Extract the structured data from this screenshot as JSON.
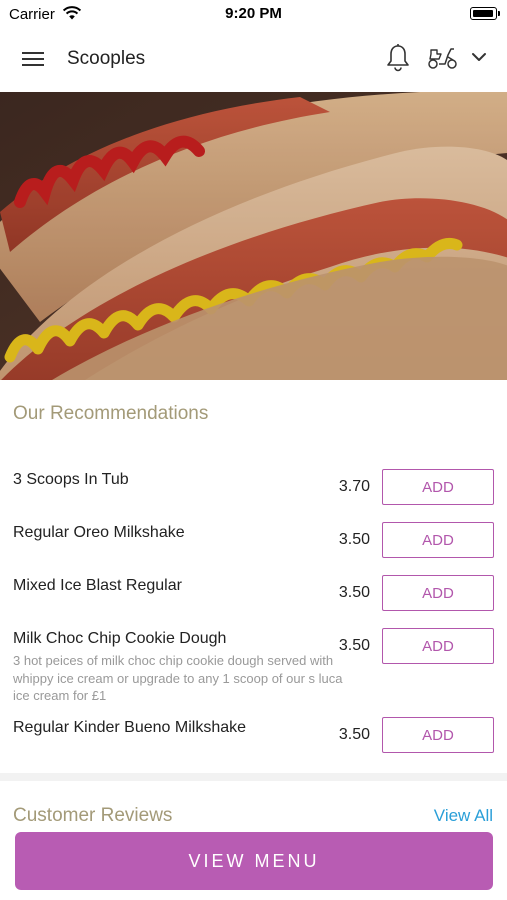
{
  "status_bar": {
    "carrier": "Carrier",
    "time": "9:20 PM"
  },
  "header": {
    "title": "Scooples",
    "icons": [
      "hamburger-menu-icon",
      "bell-icon",
      "scooter-icon",
      "chevron-down-icon"
    ]
  },
  "hero": {
    "image": "hot-dogs-with-ketchup-and-mustard"
  },
  "recommendations": {
    "title": "Our Recommendations",
    "add_label": "ADD",
    "items": [
      {
        "name": "3 Scoops In Tub",
        "price": "3.70",
        "description": ""
      },
      {
        "name": "Regular Oreo Milkshake",
        "price": "3.50",
        "description": ""
      },
      {
        "name": "Mixed Ice Blast Regular",
        "price": "3.50",
        "description": ""
      },
      {
        "name": "Milk Choc Chip Cookie Dough",
        "price": "3.50",
        "description": "3 hot peices of milk choc chip cookie dough served with whippy ice cream or upgrade to any 1 scoop of our s luca ice cream for £1"
      },
      {
        "name": "Regular Kinder Bueno Milkshake",
        "price": "3.50",
        "description": ""
      }
    ]
  },
  "reviews": {
    "title": "Customer Reviews",
    "view_all": "View All"
  },
  "footer": {
    "view_menu": "VIEW MENU"
  },
  "colors": {
    "accent": "#b85cb3",
    "section_title": "#a39a78",
    "link": "#2a9fd8"
  }
}
